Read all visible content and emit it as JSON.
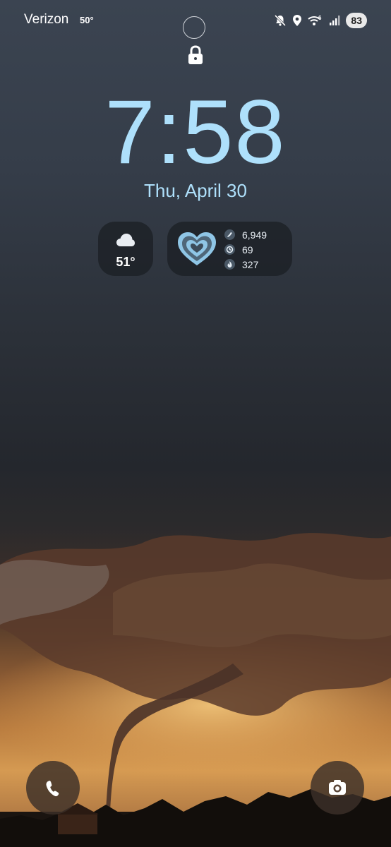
{
  "status_bar": {
    "carrier": "Verizon",
    "temperature": "50°",
    "battery": "83",
    "icons": [
      "mute-icon",
      "location-icon",
      "wifi-6-icon",
      "signal-icon"
    ]
  },
  "lock_icon": "lock-icon",
  "clock": {
    "time": "7:58",
    "date": "Thu, April 30"
  },
  "weather_widget": {
    "icon": "cloud-icon",
    "temperature": "51°"
  },
  "health_widget": {
    "icon": "heart-rings-icon",
    "stats": [
      {
        "icon": "steps-icon",
        "value": "6,949"
      },
      {
        "icon": "active-time-icon",
        "value": "69"
      },
      {
        "icon": "calories-icon",
        "value": "327"
      }
    ]
  },
  "shortcuts": {
    "left": "phone-icon",
    "right": "camera-icon"
  },
  "colors": {
    "clock": "#aee0fb",
    "widget_bg": "#1e2228"
  }
}
